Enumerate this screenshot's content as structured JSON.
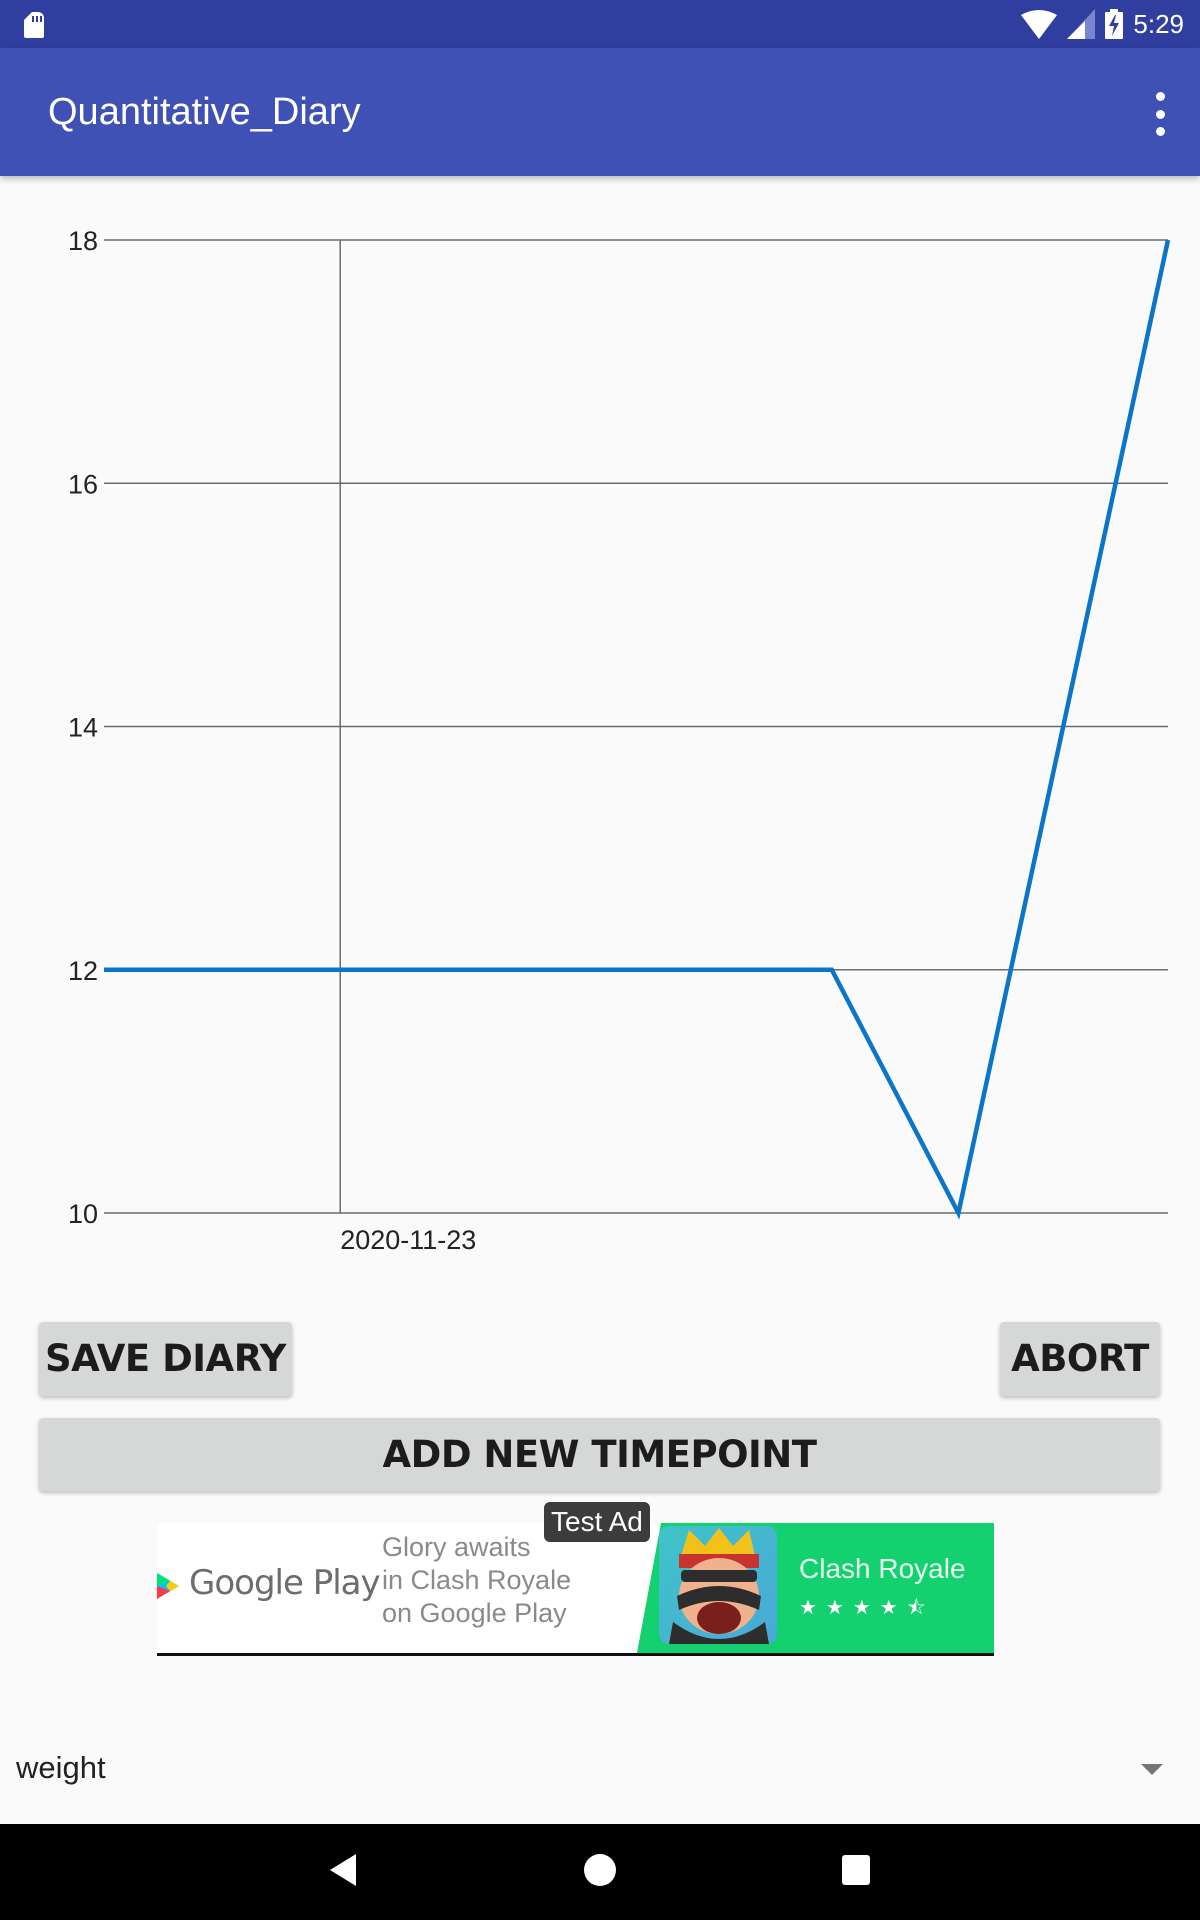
{
  "status_bar": {
    "time": "5:29",
    "icons": [
      "sd-card-icon",
      "wifi-icon",
      "cell-signal-icon",
      "battery-charging-icon"
    ]
  },
  "app_bar": {
    "title": "Quantitative_Diary",
    "overflow_icon": "more-vert-icon"
  },
  "chart_data": {
    "type": "line",
    "title": "",
    "xlabel": "",
    "ylabel": "",
    "ylim": [
      10,
      18
    ],
    "yticks": [
      10,
      12,
      14,
      16,
      18
    ],
    "ytick_labels": [
      "10",
      "12",
      "14",
      "16",
      "18"
    ],
    "xtick_labels": [
      "2020-11-23"
    ],
    "xtick_fraction": 0.222,
    "grid": true,
    "legend": "none",
    "series": [
      {
        "name": "weight",
        "color": "#0b75c9",
        "x_fraction": [
          0.0,
          0.684,
          0.803,
          1.0
        ],
        "values": [
          12,
          12,
          10,
          18
        ]
      }
    ]
  },
  "buttons": {
    "save": "SAVE DIARY",
    "abort": "ABORT",
    "add_timepoint": "ADD NEW TIMEPOINT"
  },
  "ad": {
    "badge": "Test Ad",
    "brand": "Google Play",
    "tagline_lines": [
      "Glory awaits",
      "in Clash Royale",
      "on Google Play"
    ],
    "app_name": "Clash Royale",
    "rating": 4.5,
    "stars": "★★★★⯪",
    "colors": {
      "green": "#13d16f"
    }
  },
  "spinner": {
    "selected": "weight"
  },
  "nav_bar": {
    "icons": [
      "back-icon",
      "home-icon",
      "recents-icon"
    ]
  }
}
